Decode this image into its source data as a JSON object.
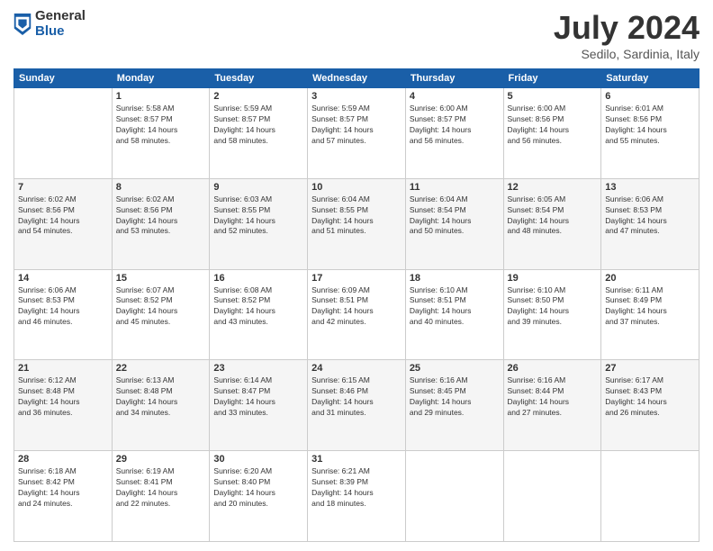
{
  "logo": {
    "general": "General",
    "blue": "Blue"
  },
  "title": "July 2024",
  "subtitle": "Sedilo, Sardinia, Italy",
  "days_header": [
    "Sunday",
    "Monday",
    "Tuesday",
    "Wednesday",
    "Thursday",
    "Friday",
    "Saturday"
  ],
  "weeks": [
    [
      {
        "num": "",
        "info": ""
      },
      {
        "num": "1",
        "info": "Sunrise: 5:58 AM\nSunset: 8:57 PM\nDaylight: 14 hours\nand 58 minutes."
      },
      {
        "num": "2",
        "info": "Sunrise: 5:59 AM\nSunset: 8:57 PM\nDaylight: 14 hours\nand 58 minutes."
      },
      {
        "num": "3",
        "info": "Sunrise: 5:59 AM\nSunset: 8:57 PM\nDaylight: 14 hours\nand 57 minutes."
      },
      {
        "num": "4",
        "info": "Sunrise: 6:00 AM\nSunset: 8:57 PM\nDaylight: 14 hours\nand 56 minutes."
      },
      {
        "num": "5",
        "info": "Sunrise: 6:00 AM\nSunset: 8:56 PM\nDaylight: 14 hours\nand 56 minutes."
      },
      {
        "num": "6",
        "info": "Sunrise: 6:01 AM\nSunset: 8:56 PM\nDaylight: 14 hours\nand 55 minutes."
      }
    ],
    [
      {
        "num": "7",
        "info": "Sunrise: 6:02 AM\nSunset: 8:56 PM\nDaylight: 14 hours\nand 54 minutes."
      },
      {
        "num": "8",
        "info": "Sunrise: 6:02 AM\nSunset: 8:56 PM\nDaylight: 14 hours\nand 53 minutes."
      },
      {
        "num": "9",
        "info": "Sunrise: 6:03 AM\nSunset: 8:55 PM\nDaylight: 14 hours\nand 52 minutes."
      },
      {
        "num": "10",
        "info": "Sunrise: 6:04 AM\nSunset: 8:55 PM\nDaylight: 14 hours\nand 51 minutes."
      },
      {
        "num": "11",
        "info": "Sunrise: 6:04 AM\nSunset: 8:54 PM\nDaylight: 14 hours\nand 50 minutes."
      },
      {
        "num": "12",
        "info": "Sunrise: 6:05 AM\nSunset: 8:54 PM\nDaylight: 14 hours\nand 48 minutes."
      },
      {
        "num": "13",
        "info": "Sunrise: 6:06 AM\nSunset: 8:53 PM\nDaylight: 14 hours\nand 47 minutes."
      }
    ],
    [
      {
        "num": "14",
        "info": "Sunrise: 6:06 AM\nSunset: 8:53 PM\nDaylight: 14 hours\nand 46 minutes."
      },
      {
        "num": "15",
        "info": "Sunrise: 6:07 AM\nSunset: 8:52 PM\nDaylight: 14 hours\nand 45 minutes."
      },
      {
        "num": "16",
        "info": "Sunrise: 6:08 AM\nSunset: 8:52 PM\nDaylight: 14 hours\nand 43 minutes."
      },
      {
        "num": "17",
        "info": "Sunrise: 6:09 AM\nSunset: 8:51 PM\nDaylight: 14 hours\nand 42 minutes."
      },
      {
        "num": "18",
        "info": "Sunrise: 6:10 AM\nSunset: 8:51 PM\nDaylight: 14 hours\nand 40 minutes."
      },
      {
        "num": "19",
        "info": "Sunrise: 6:10 AM\nSunset: 8:50 PM\nDaylight: 14 hours\nand 39 minutes."
      },
      {
        "num": "20",
        "info": "Sunrise: 6:11 AM\nSunset: 8:49 PM\nDaylight: 14 hours\nand 37 minutes."
      }
    ],
    [
      {
        "num": "21",
        "info": "Sunrise: 6:12 AM\nSunset: 8:48 PM\nDaylight: 14 hours\nand 36 minutes."
      },
      {
        "num": "22",
        "info": "Sunrise: 6:13 AM\nSunset: 8:48 PM\nDaylight: 14 hours\nand 34 minutes."
      },
      {
        "num": "23",
        "info": "Sunrise: 6:14 AM\nSunset: 8:47 PM\nDaylight: 14 hours\nand 33 minutes."
      },
      {
        "num": "24",
        "info": "Sunrise: 6:15 AM\nSunset: 8:46 PM\nDaylight: 14 hours\nand 31 minutes."
      },
      {
        "num": "25",
        "info": "Sunrise: 6:16 AM\nSunset: 8:45 PM\nDaylight: 14 hours\nand 29 minutes."
      },
      {
        "num": "26",
        "info": "Sunrise: 6:16 AM\nSunset: 8:44 PM\nDaylight: 14 hours\nand 27 minutes."
      },
      {
        "num": "27",
        "info": "Sunrise: 6:17 AM\nSunset: 8:43 PM\nDaylight: 14 hours\nand 26 minutes."
      }
    ],
    [
      {
        "num": "28",
        "info": "Sunrise: 6:18 AM\nSunset: 8:42 PM\nDaylight: 14 hours\nand 24 minutes."
      },
      {
        "num": "29",
        "info": "Sunrise: 6:19 AM\nSunset: 8:41 PM\nDaylight: 14 hours\nand 22 minutes."
      },
      {
        "num": "30",
        "info": "Sunrise: 6:20 AM\nSunset: 8:40 PM\nDaylight: 14 hours\nand 20 minutes."
      },
      {
        "num": "31",
        "info": "Sunrise: 6:21 AM\nSunset: 8:39 PM\nDaylight: 14 hours\nand 18 minutes."
      },
      {
        "num": "",
        "info": ""
      },
      {
        "num": "",
        "info": ""
      },
      {
        "num": "",
        "info": ""
      }
    ]
  ]
}
